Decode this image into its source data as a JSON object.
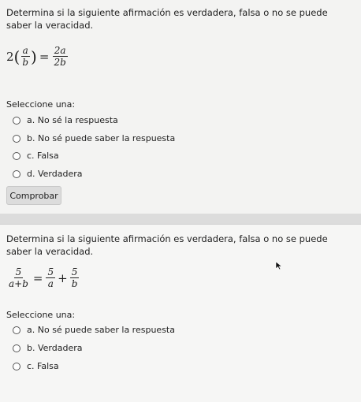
{
  "question1": {
    "text": "Determina si la siguiente afirmación es verdadera, falsa o no se puede saber la veracidad.",
    "equation": {
      "coef": "2",
      "lhs_num": "a",
      "lhs_den": "b",
      "eq": "=",
      "rhs_num": "2a",
      "rhs_den": "2b"
    },
    "prompt": "Seleccione una:",
    "options": [
      "a.  No sé la respuesta",
      "b.  No sé puede saber la respuesta",
      "c.  Falsa",
      "d.  Verdadera"
    ],
    "button": "Comprobar"
  },
  "question2": {
    "text": "Determina si la siguiente afirmación es verdadera, falsa o no se puede saber la veracidad.",
    "equation": {
      "lhs_num": "5",
      "lhs_den": "a+b",
      "eq": "=",
      "r1_num": "5",
      "r1_den": "a",
      "plus": "+",
      "r2_num": "5",
      "r2_den": "b"
    },
    "prompt": "Seleccione una:",
    "options": [
      "a.  No sé puede saber la respuesta",
      "b.  Verdadera",
      "c.  Falsa"
    ]
  }
}
